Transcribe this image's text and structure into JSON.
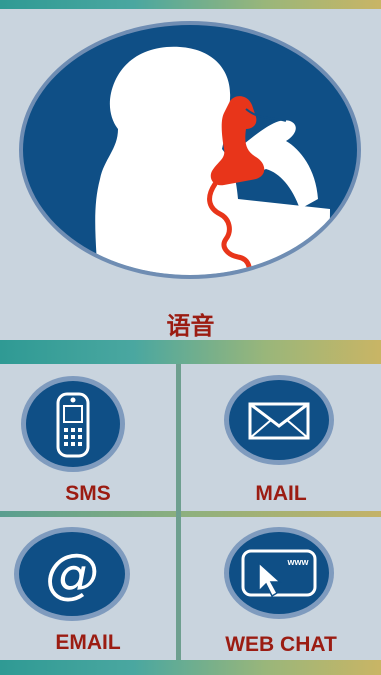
{
  "voice": {
    "label": "语音"
  },
  "channels": [
    {
      "label": "SMS",
      "icon": "mobile-phone-icon"
    },
    {
      "label": "MAIL",
      "icon": "envelope-icon"
    },
    {
      "label": "EMAIL",
      "icon": "at-sign-icon"
    },
    {
      "label": "WEB CHAT",
      "icon": "web-cursor-icon",
      "icon_text": "www"
    }
  ],
  "colors": {
    "accent_text": "#9b1c12",
    "icon_blue": "#0f4f86",
    "background": "#c9d4de"
  }
}
